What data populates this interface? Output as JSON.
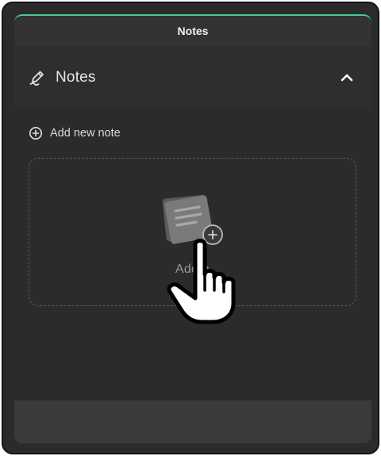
{
  "window": {
    "title": "Notes",
    "accent": "#3ecf8e"
  },
  "section": {
    "title": "Notes",
    "icon": "pen-icon",
    "toggle_icon": "chevron-up-icon"
  },
  "actions": {
    "add_new_note": "Add new note",
    "add_icon": "plus-circle-icon"
  },
  "empty_state": {
    "icon": "notes-stack-icon",
    "text": "Add a"
  },
  "cursor": {
    "icon": "hand-pointer-icon"
  }
}
